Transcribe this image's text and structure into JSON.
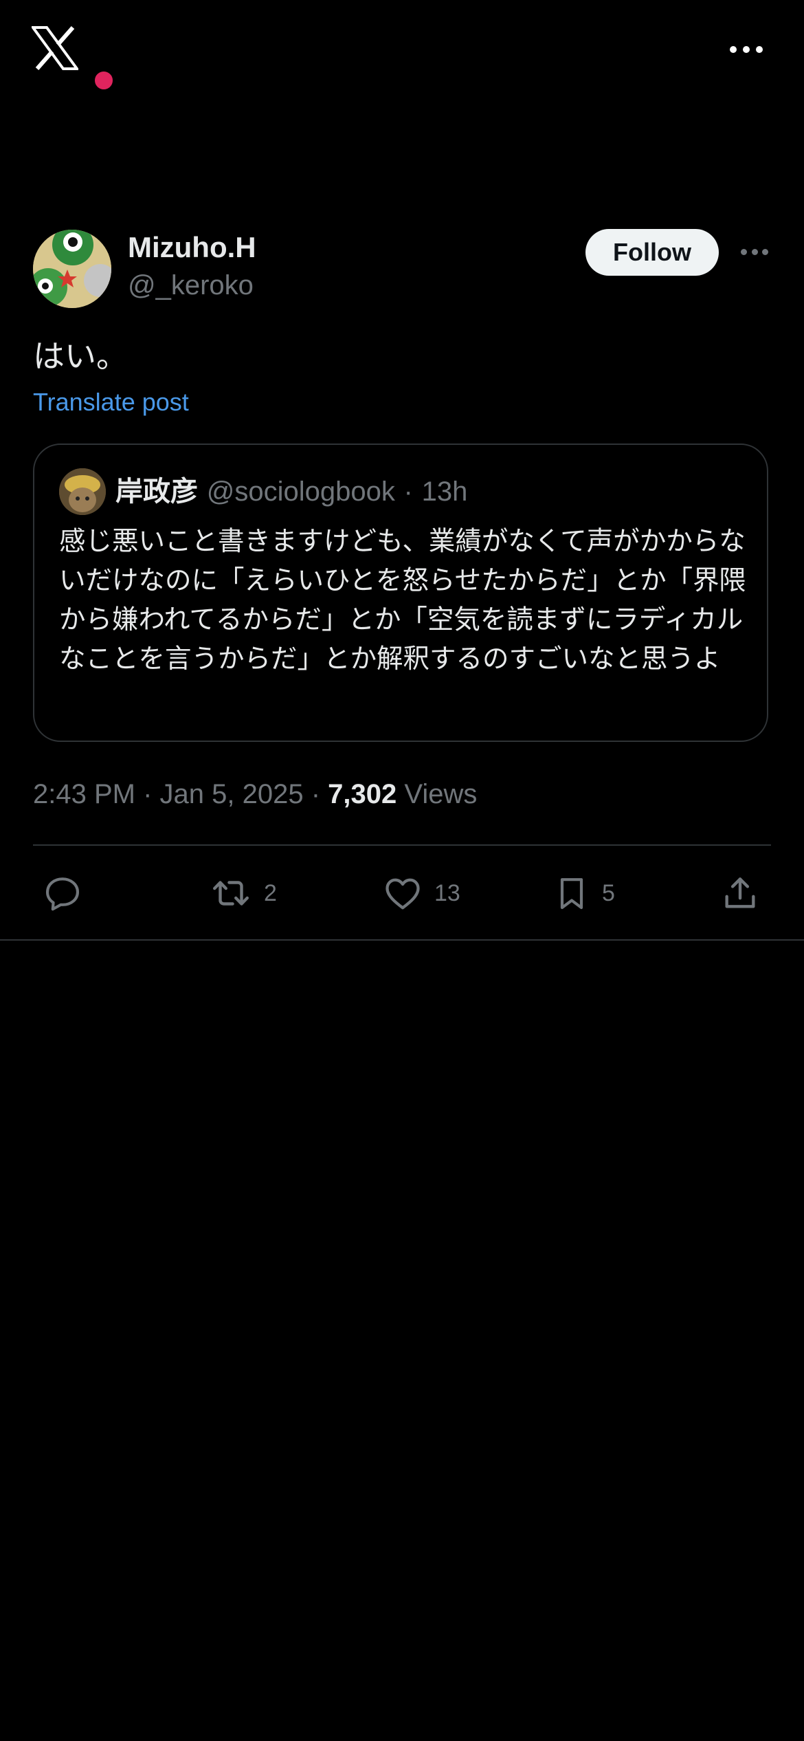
{
  "top_bar": {
    "logo_icon": "x-logo-icon",
    "more_icon": "more-horizontal-icon"
  },
  "post": {
    "author": {
      "display_name": "Mizuho.H",
      "handle": "@_keroko"
    },
    "follow_label": "Follow",
    "text": "はい。",
    "translate_label": "Translate post",
    "quoted": {
      "display_name": "岸政彦",
      "handle": "@sociologbook",
      "separator": "·",
      "time": "13h",
      "text": "感じ悪いこと書きますけども、業績がなくて声がかからないだけなのに「えらいひとを怒らせたからだ」とか「界隈から嫌われてるからだ」とか「空気を読まずにラディカルなことを言うからだ」とか解釈するのすごいなと思うよ"
    },
    "meta": {
      "timestamp": "2:43 PM · Jan 5, 2025 ·",
      "views_count": "7,302",
      "views_label": "Views"
    },
    "actions": {
      "reply_count": "",
      "repost_count": "2",
      "like_count": "13",
      "bookmark_count": "5"
    }
  },
  "colors": {
    "background": "#000000",
    "text_primary": "#e7e9ea",
    "text_secondary": "#71767b",
    "link": "#4a99e9",
    "border": "#2f3336",
    "follow_bg": "#eff3f4"
  }
}
